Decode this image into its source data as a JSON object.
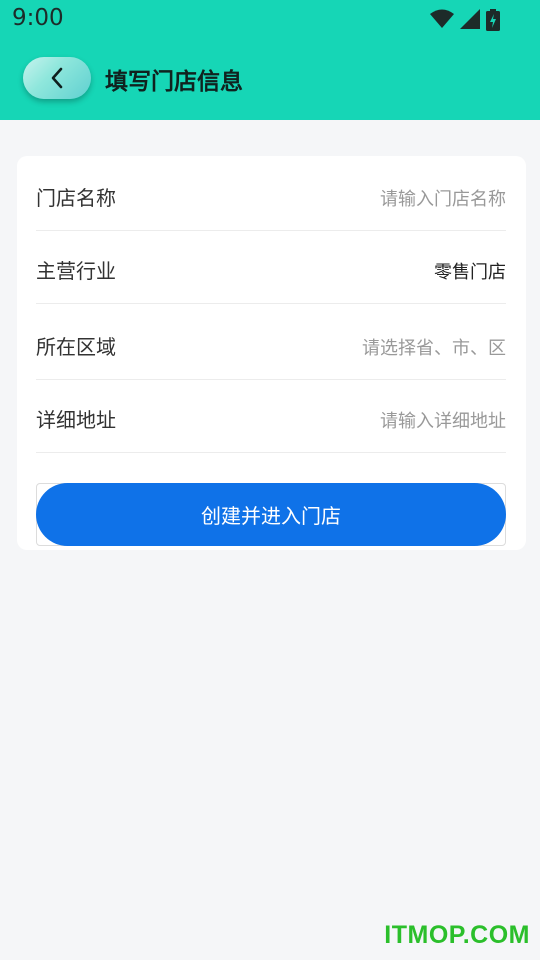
{
  "status_bar": {
    "time": "9:00",
    "icons": [
      "wifi-icon",
      "signal-icon",
      "battery-icon"
    ]
  },
  "header": {
    "back_icon": "chevron-left-icon",
    "title": "填写门店信息"
  },
  "form": {
    "fields": [
      {
        "label": "门店名称",
        "placeholder": "请输入门店名称",
        "value": ""
      },
      {
        "label": "主营行业",
        "placeholder": "",
        "value": "零售门店"
      },
      {
        "label": "所在区域",
        "placeholder": "请选择省、市、区",
        "value": ""
      },
      {
        "label": "详细地址",
        "placeholder": "请输入详细地址",
        "value": ""
      }
    ],
    "submit_label": "创建并进入门店"
  },
  "watermark": "ITMOP.COM",
  "colors": {
    "header_bg": "#16d6b6",
    "primary_button": "#0f72e8",
    "page_bg": "#f5f6f8"
  }
}
